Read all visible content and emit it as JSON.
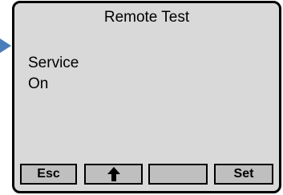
{
  "screen": {
    "title": "Remote Test",
    "lines": [
      "Service",
      "On"
    ]
  },
  "softkeys": [
    {
      "label": "Esc"
    },
    {
      "label": "",
      "icon": "up-arrow-icon"
    },
    {
      "label": ""
    },
    {
      "label": "Set"
    }
  ],
  "colors": {
    "screen_background": "#d9d9d9",
    "key_background": "#bfbfbf",
    "pointer": "#4a7ebb"
  }
}
